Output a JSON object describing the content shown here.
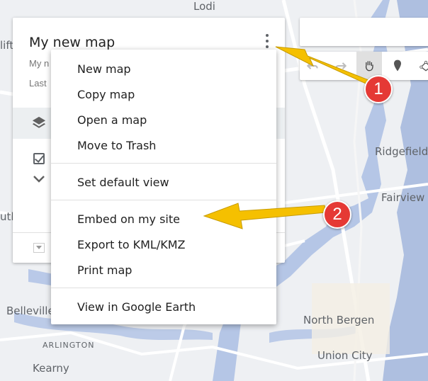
{
  "map": {
    "places": [
      "Lodi",
      "Ridgefield",
      "Fairview",
      "Belleville",
      "ARLINGTON",
      "Kearny",
      "North Bergen",
      "Union City"
    ],
    "partial_labels": [
      "lift",
      "utle"
    ]
  },
  "panel": {
    "title": "My new map",
    "subtitle_partial": "My n",
    "last_edited_partial": "Last"
  },
  "menu": {
    "items": [
      "New map",
      "Copy map",
      "Open a map",
      "Move to Trash",
      "Set default view",
      "Embed on my site",
      "Export to KML/KMZ",
      "Print map",
      "View in Google Earth"
    ]
  },
  "annotations": {
    "badges": [
      "1",
      "2"
    ],
    "colors": {
      "badge": "#e53935",
      "arrow": "#f5c000"
    }
  },
  "icons": [
    "more-vert-icon",
    "layers-icon",
    "checkbox-icon",
    "chevron-down-icon",
    "undo-icon",
    "redo-icon",
    "hand-icon",
    "marker-icon",
    "draw-line-icon"
  ]
}
